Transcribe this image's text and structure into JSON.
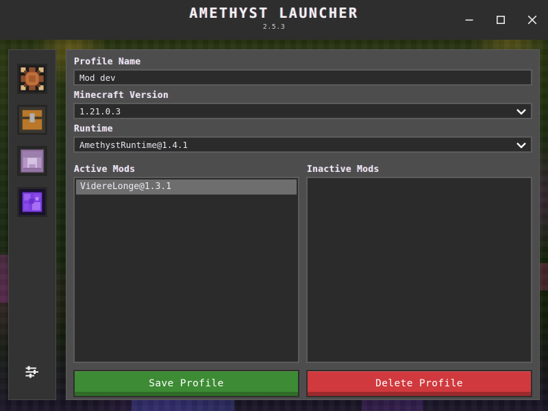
{
  "window": {
    "title": "AMETHYST LAUNCHER",
    "version": "2.5.3",
    "minimize_label": "minimize",
    "maximize_label": "maximize",
    "close_label": "close"
  },
  "sidebar": {
    "items": [
      {
        "name": "decorated-pot-icon",
        "label": "Instances"
      },
      {
        "name": "chest-icon",
        "label": "Mods"
      },
      {
        "name": "purple-anvil-icon",
        "label": "Runtimes"
      },
      {
        "name": "amethyst-block-icon",
        "label": "Amethyst"
      }
    ],
    "settings": {
      "name": "settings-sliders-icon",
      "label": "Settings"
    }
  },
  "form": {
    "profile_name": {
      "label": "Profile Name",
      "value": "Mod dev",
      "placeholder": "Profile Name"
    },
    "minecraft_version": {
      "label": "Minecraft Version",
      "value": "1.21.0.3"
    },
    "runtime": {
      "label": "Runtime",
      "value": "AmethystRuntime@1.4.1"
    }
  },
  "mods": {
    "active": {
      "label": "Active Mods",
      "items": [
        {
          "name": "VidereLonge@1.3.1",
          "selected": true
        }
      ]
    },
    "inactive": {
      "label": "Inactive Mods",
      "items": []
    }
  },
  "actions": {
    "save": {
      "label": "Save Profile",
      "color": "#3d8b34"
    },
    "delete": {
      "label": "Delete Profile",
      "color": "#d0393d"
    }
  },
  "theme": {
    "titlebar_bg": "#2e2e2e",
    "panel_bg": "#4d4d4d",
    "sidebar_bg": "#333333",
    "input_bg": "#2b2b2b",
    "input_border": "#5c5c5c",
    "selection_bg": "#6e6e6e",
    "text": "#e8e8f0"
  }
}
